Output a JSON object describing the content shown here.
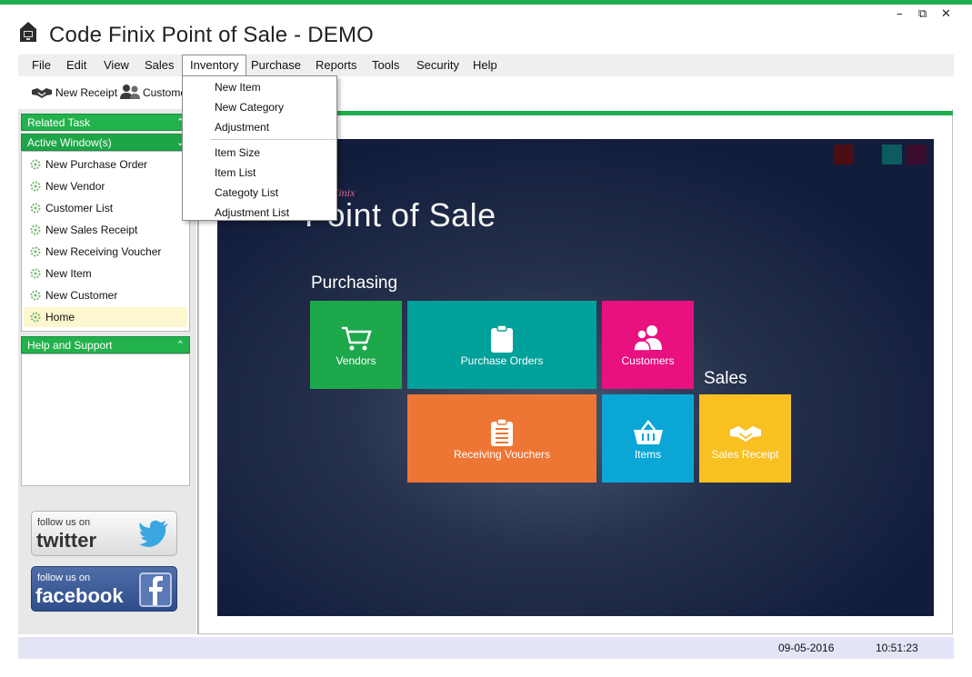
{
  "window": {
    "title": "Code Finix Point of Sale - DEMO",
    "controls": {
      "minimize": "–",
      "restore": "⧉",
      "close": "✕"
    }
  },
  "menubar": {
    "items": [
      "File",
      "Edit",
      "View",
      "Sales",
      "Inventory",
      "Purchase",
      "Reports",
      "Tools",
      "Security",
      "Help"
    ],
    "active": "Inventory"
  },
  "inventory_menu": {
    "items": [
      "New Item",
      "New Category",
      "Adjustment",
      "Item Size",
      "Item List",
      "Categoty List",
      "Adjustment List"
    ]
  },
  "toolbar": {
    "new_receipt": "New Receipt",
    "customer": "Customer"
  },
  "left_panel": {
    "related_task": "Related Task",
    "active_windows": "Active Window(s)",
    "help_support": "Help and Support",
    "tasks": [
      "New Purchase Order",
      "New Vendor",
      "Customer List",
      "New Sales Receipt",
      "New Receiving Voucher",
      "New Item",
      "New Customer",
      "Home"
    ],
    "selected_task": "Home",
    "twitter": {
      "line1": "follow us on",
      "line2": "twitter"
    },
    "facebook": {
      "line1": "follow us on",
      "line2": "facebook"
    }
  },
  "dashboard": {
    "brand_small": "Finix",
    "brand_big": "Point of Sale",
    "purchasing_title": "Purchasing",
    "sales_title": "Sales",
    "squares": [
      "#4a0f14",
      "#0b5b60",
      "#3a0d2e"
    ],
    "tiles": {
      "vendors": {
        "label": "Vendors",
        "color": "#1ea84c",
        "icon": "cart-icon"
      },
      "purchase_orders": {
        "label": "Purchase Orders",
        "color": "#00a19a",
        "icon": "clipboard-icon"
      },
      "customers": {
        "label": "Customers",
        "color": "#e8117f",
        "icon": "users-icon"
      },
      "receiving_vouchers": {
        "label": "Receiving Vouchers",
        "color": "#ee7634",
        "icon": "list-icon"
      },
      "items": {
        "label": "Items",
        "color": "#0aa7d6",
        "icon": "basket-icon"
      },
      "sales_receipt": {
        "label": "Sales Receipt",
        "color": "#f9c021",
        "icon": "handshake-icon"
      }
    }
  },
  "status": {
    "date": "09-05-2016",
    "time": "10:51:23"
  }
}
